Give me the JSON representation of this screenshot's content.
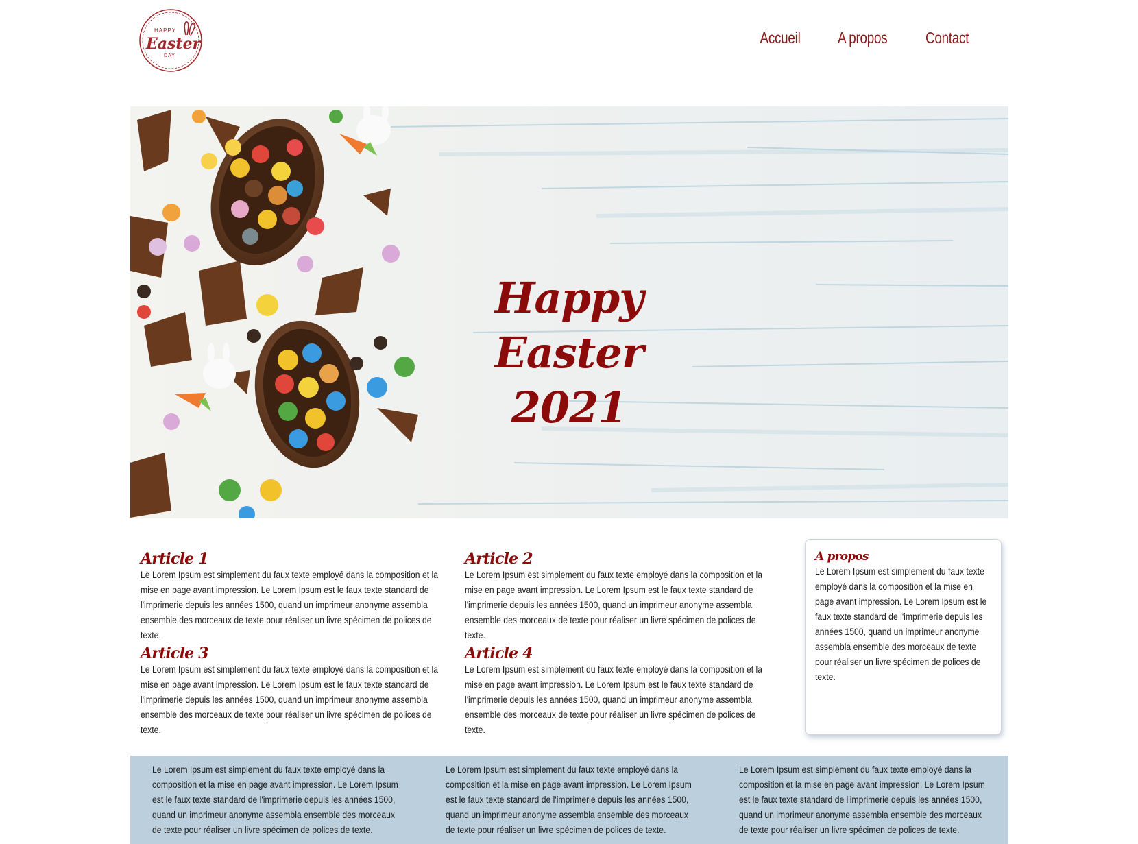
{
  "header": {
    "logo": {
      "line1": "HAPPY",
      "line2": "Easter",
      "line3": "DAY",
      "icon": "easter-bunny-logo"
    },
    "nav": [
      {
        "label": "Accueil"
      },
      {
        "label": "A propos"
      },
      {
        "label": "Contact"
      }
    ]
  },
  "hero": {
    "title_line1": "Happy Easter",
    "title_line2": "2021",
    "image": "chocolate-eggs-candies-photo"
  },
  "articles": [
    {
      "title": "Article 1",
      "body": "Le Lorem Ipsum est simplement du faux texte employé dans la composition et la mise en page avant impression. Le Lorem Ipsum est le faux texte standard de l'imprimerie depuis les années 1500, quand un imprimeur anonyme assembla ensemble des morceaux de texte pour réaliser un livre spécimen de polices de texte."
    },
    {
      "title": "Article 2",
      "body": "Le Lorem Ipsum est simplement du faux texte employé dans la composition et la mise en page avant impression. Le Lorem Ipsum est le faux texte standard de l'imprimerie depuis les années 1500, quand un imprimeur anonyme assembla ensemble des morceaux de texte pour réaliser un livre spécimen de polices de texte."
    },
    {
      "title": "Article 3",
      "body": "Le Lorem Ipsum est simplement du faux texte employé dans la composition et la mise en page avant impression. Le Lorem Ipsum est le faux texte standard de l'imprimerie depuis les années 1500, quand un imprimeur anonyme assembla ensemble des morceaux de texte pour réaliser un livre spécimen de polices de texte."
    },
    {
      "title": "Article 4",
      "body": "Le Lorem Ipsum est simplement du faux texte employé dans la composition et la mise en page avant impression. Le Lorem Ipsum est le faux texte standard de l'imprimerie depuis les années 1500, quand un imprimeur anonyme assembla ensemble des morceaux de texte pour réaliser un livre spécimen de polices de texte."
    }
  ],
  "aside": {
    "title": "A propos",
    "body": "Le Lorem Ipsum est simplement du faux texte employé dans la composition et la mise en page avant impression. Le Lorem Ipsum est le faux texte standard de l'imprimerie depuis les années 1500, quand un imprimeur anonyme assembla ensemble des morceaux de texte pour réaliser un livre spécimen de polices de texte."
  },
  "footer": {
    "columns": [
      {
        "body": "Le Lorem Ipsum est simplement du faux texte employé dans la composition et la mise en page avant impression. Le Lorem Ipsum est le faux texte standard de l'imprimerie depuis les années 1500, quand un imprimeur anonyme assembla ensemble des morceaux de texte pour réaliser un livre spécimen de polices de texte."
      },
      {
        "body": "Le Lorem Ipsum est simplement du faux texte employé dans la composition et la mise en page avant impression. Le Lorem Ipsum est le faux texte standard de l'imprimerie depuis les années 1500, quand un imprimeur anonyme assembla ensemble des morceaux de texte pour réaliser un livre spécimen de polices de texte."
      },
      {
        "body": "Le Lorem Ipsum est simplement du faux texte employé dans la composition et la mise en page avant impression. Le Lorem Ipsum est le faux texte standard de l'imprimerie depuis les années 1500, quand un imprimeur anonyme assembla ensemble des morceaux de texte pour réaliser un livre spécimen de polices de texte."
      }
    ],
    "background": "#bccfdc"
  },
  "colors": {
    "accent": "#8b0a0a",
    "text": "#222222"
  }
}
